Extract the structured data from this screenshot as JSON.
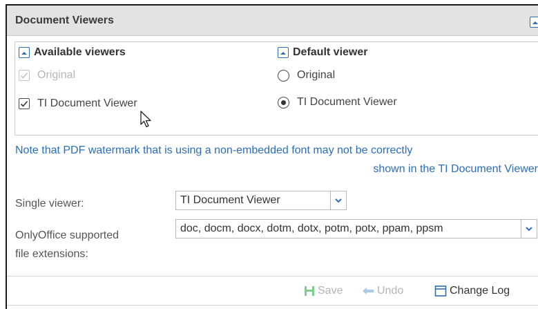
{
  "header": {
    "title": "Document Viewers"
  },
  "available": {
    "title": "Available viewers",
    "options": [
      {
        "label": "Original",
        "checked": true,
        "disabled": true
      },
      {
        "label": "TI Document Viewer",
        "checked": true,
        "disabled": false
      }
    ]
  },
  "default_viewer": {
    "title": "Default viewer",
    "options": [
      {
        "label": "Original",
        "selected": false
      },
      {
        "label": "TI Document Viewer",
        "selected": true
      }
    ]
  },
  "note": {
    "line1": "Note that PDF watermark that is using a non-embedded font may not be correctly",
    "line2": "shown in the TI Document Viewer"
  },
  "single_viewer": {
    "label": "Single viewer:",
    "value": "TI Document Viewer"
  },
  "onlyoffice": {
    "label_line1": "OnlyOffice supported",
    "label_line2": "file extensions:",
    "value": "doc, docm, docx, dotm, dotx, potm, potx, ppam, ppsm"
  },
  "footer": {
    "save": "Save",
    "undo": "Undo",
    "change_log": "Change Log"
  },
  "colors": {
    "accent": "#2a6ebb",
    "header_bg": "#e3e3e3",
    "disabled": "#b5b5b5",
    "save_icon": "#7ccf8a"
  }
}
